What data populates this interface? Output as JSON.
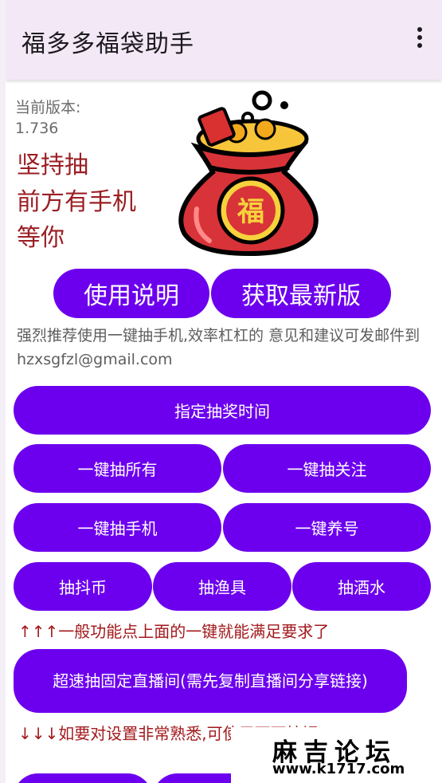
{
  "app": {
    "title": "福多多福袋助手"
  },
  "info": {
    "version_label": "当前版本:",
    "version_value": "1.736",
    "slogan": [
      "坚持抽",
      "前方有手机",
      "等你"
    ]
  },
  "top_buttons": {
    "instructions": "使用说明",
    "get_latest": "获取最新版"
  },
  "recommend_text": "强烈推荐使用一键抽手机,效率杠杠的 意见和建议可发邮件到 hzxsgfzl@gmail.com",
  "buttons": {
    "schedule": "指定抽奖时间",
    "draw_all": "一键抽所有",
    "draw_follow": "一键抽关注",
    "draw_phone": "一键抽手机",
    "nurture": "一键养号",
    "douyin_coin": "抽抖币",
    "fishing_gear": "抽渔具",
    "liquor": "抽酒水",
    "fast_live": "超速抽固定直播间(需先复制直播间分享链接)"
  },
  "notes": {
    "up": "↑↑↑一般功能点上面的一键就能满足要求了",
    "down": "↓↓↓如要对设置非常熟悉,可使用下面按钮"
  },
  "watermark": {
    "title": "麻吉论坛",
    "url": "www.k1717.com"
  },
  "colors": {
    "button": "#6c00ee",
    "accent_text": "#9b1e23",
    "titlebar": "#f3e9f6"
  },
  "icons": {
    "menu": "more-vert-icon",
    "illustration": "lucky-bag-icon"
  }
}
